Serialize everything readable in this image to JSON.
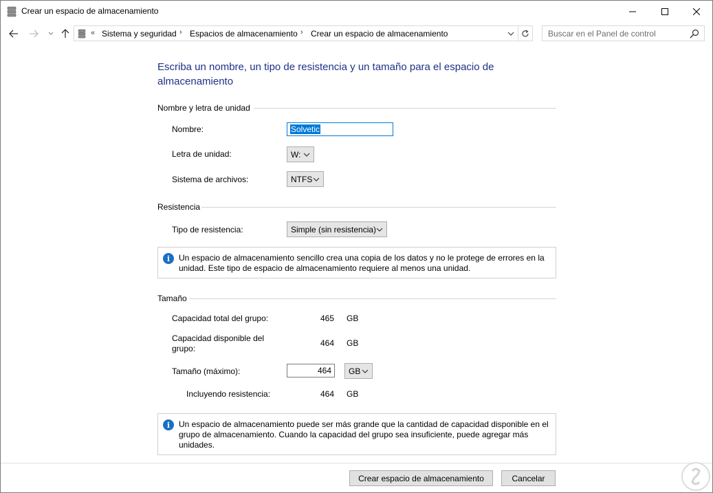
{
  "window": {
    "title": "Crear un espacio de almacenamiento",
    "minimize_icon": "minimize-icon",
    "maximize_icon": "maximize-icon",
    "close_icon": "close-icon"
  },
  "nav": {
    "overflow": "«",
    "breadcrumbs": [
      "Sistema y seguridad",
      "Espacios de almacenamiento",
      "Crear un espacio de almacenamiento"
    ],
    "separator": "›",
    "search_placeholder": "Buscar en el Panel de control"
  },
  "heading": "Escriba un nombre, un tipo de resistencia y un tamaño para el espacio de almacenamiento",
  "name_section": {
    "title": "Nombre y letra de unidad",
    "name_label": "Nombre:",
    "name_value": "Solvetic",
    "drive_letter_label": "Letra de unidad:",
    "drive_letter_value": "W:",
    "filesystem_label": "Sistema de archivos:",
    "filesystem_value": "NTFS"
  },
  "resiliency_section": {
    "title": "Resistencia",
    "type_label": "Tipo de resistencia:",
    "type_value": "Simple (sin resistencia)",
    "info": "Un espacio de almacenamiento sencillo crea una copia de los datos y no le protege de errores en la unidad. Este tipo de espacio de almacenamiento requiere al menos una unidad."
  },
  "size_section": {
    "title": "Tamaño",
    "total_label": "Capacidad total del grupo:",
    "total_value": "465",
    "total_unit": "GB",
    "available_label": "Capacidad disponible del grupo:",
    "available_value": "464",
    "available_unit": "GB",
    "size_label": "Tamaño (máximo):",
    "size_value": "464",
    "size_unit": "GB",
    "including_label": "Incluyendo resistencia:",
    "including_value": "464",
    "including_unit": "GB",
    "info": "Un espacio de almacenamiento puede ser más grande que la cantidad de capacidad disponible en el grupo de almacenamiento. Cuando la capacidad del grupo sea insuficiente, puede agregar más unidades."
  },
  "buttons": {
    "create": "Crear espacio de almacenamiento",
    "cancel": "Cancelar"
  },
  "colors": {
    "heading": "#1e3287",
    "accent": "#0078d7",
    "info_icon": "#1b6fc2"
  }
}
